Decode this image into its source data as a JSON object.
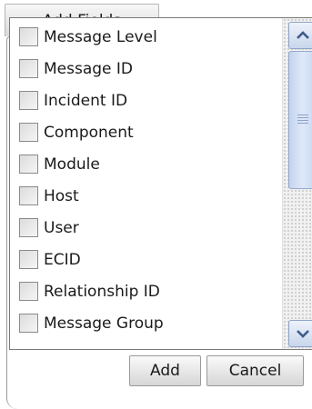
{
  "dialog": {
    "title": "Add Fields"
  },
  "fields": [
    {
      "label": "Message Level",
      "checked": false
    },
    {
      "label": "Message ID",
      "checked": false
    },
    {
      "label": "Incident ID",
      "checked": false
    },
    {
      "label": "Component",
      "checked": false
    },
    {
      "label": "Module",
      "checked": false
    },
    {
      "label": "Host",
      "checked": false
    },
    {
      "label": "User",
      "checked": false
    },
    {
      "label": "ECID",
      "checked": false
    },
    {
      "label": "Relationship ID",
      "checked": false
    },
    {
      "label": "Message Group",
      "checked": false
    }
  ],
  "scrollbar": {
    "up_icon": "chevron-up-icon",
    "down_icon": "chevron-down-icon"
  },
  "buttons": {
    "add_label": "Add",
    "cancel_label": "Cancel"
  }
}
